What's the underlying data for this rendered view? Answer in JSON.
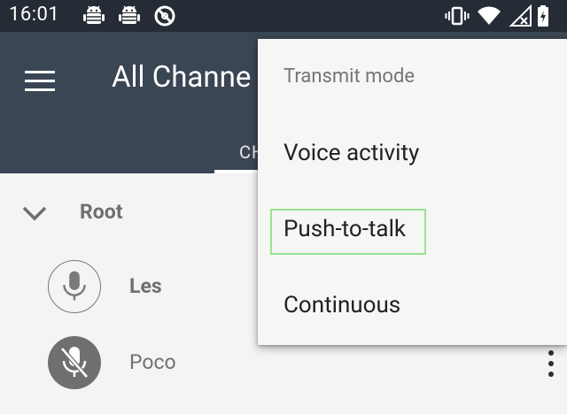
{
  "status_bar": {
    "time": "16:01",
    "left_icons": [
      "android-debug-icon",
      "android-debug-icon",
      "no-disturb-icon"
    ],
    "right_icons": [
      "vibrate-icon",
      "wifi-icon",
      "signal-icon",
      "battery-icon"
    ]
  },
  "app_bar": {
    "menu_icon": "hamburger-menu-icon",
    "title": "All Channe",
    "tab_label": "CH"
  },
  "channel_list": {
    "root_label": "Root",
    "users": [
      {
        "name": "Les",
        "icon": "microphone-icon",
        "style": "outline"
      },
      {
        "name": "Poco",
        "icon": "microphone-muted-icon",
        "style": "filled"
      }
    ]
  },
  "popup_menu": {
    "header": "Transmit mode",
    "items": [
      "Voice activity",
      "Push-to-talk",
      "Continuous"
    ],
    "highlighted": "Push-to-talk"
  },
  "colors": {
    "status_bar": "#252c35",
    "app_bar": "#3b4654",
    "background": "#f4f4f2",
    "highlight_border": "#97e592"
  }
}
